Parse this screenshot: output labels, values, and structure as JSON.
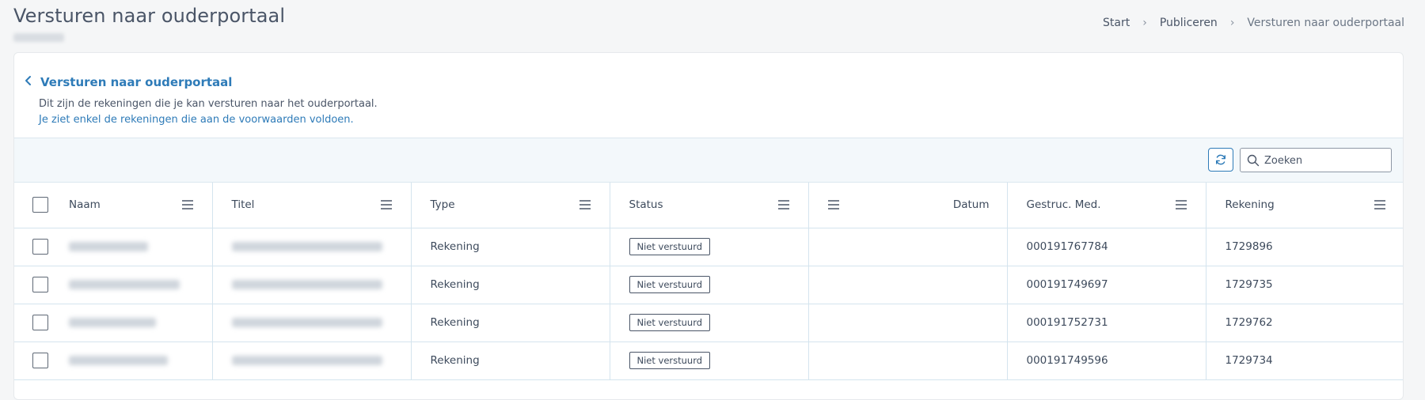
{
  "page": {
    "title": "Versturen naar ouderportaal"
  },
  "breadcrumb": [
    {
      "label": "Start"
    },
    {
      "label": "Publiceren"
    },
    {
      "label": "Versturen naar ouderportaal"
    }
  ],
  "card": {
    "title": "Versturen naar ouderportaal",
    "description_line1": "Dit zijn de rekeningen die je kan versturen naar het ouderportaal.",
    "description_line2": "Je ziet enkel de rekeningen die aan de voorwaarden voldoen."
  },
  "toolbar": {
    "refresh_icon": "refresh-icon",
    "search_placeholder": "Zoeken",
    "search_icon": "search-icon"
  },
  "table": {
    "columns": [
      {
        "key": "naam",
        "label": "Naam"
      },
      {
        "key": "titel",
        "label": "Titel"
      },
      {
        "key": "type",
        "label": "Type"
      },
      {
        "key": "status",
        "label": "Status"
      },
      {
        "key": "datum",
        "label": "Datum"
      },
      {
        "key": "gestruc",
        "label": "Gestruc. Med."
      },
      {
        "key": "rekening",
        "label": "Rekening"
      }
    ],
    "rows": [
      {
        "type": "Rekening",
        "status": "Niet verstuurd",
        "datum": "",
        "gestruc": "000191767784",
        "rekening": "1729896"
      },
      {
        "type": "Rekening",
        "status": "Niet verstuurd",
        "datum": "",
        "gestruc": "000191749697",
        "rekening": "1729735"
      },
      {
        "type": "Rekening",
        "status": "Niet verstuurd",
        "datum": "",
        "gestruc": "000191752731",
        "rekening": "1729762"
      },
      {
        "type": "Rekening",
        "status": "Niet verstuurd",
        "datum": "",
        "gestruc": "000191749596",
        "rekening": "1729734"
      }
    ]
  },
  "colors": {
    "accent": "#2e7bb8",
    "toolbar_bg": "#f3f8fb",
    "grid_line": "#d4e4ee"
  }
}
